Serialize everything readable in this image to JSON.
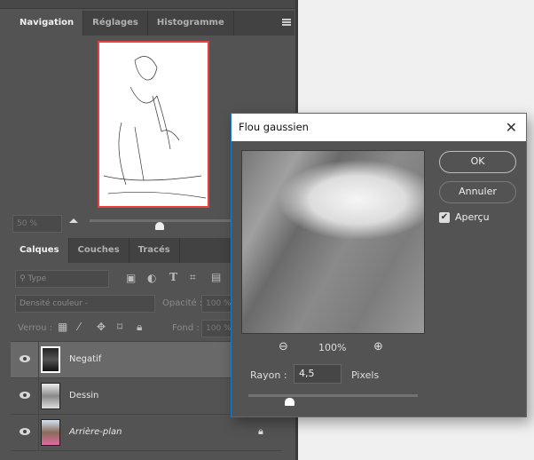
{
  "navigator": {
    "tabs": [
      "Navigation",
      "Réglages",
      "Histogramme"
    ],
    "zoom": "50 %"
  },
  "layers_panel": {
    "tabs": [
      "Calques",
      "Couches",
      "Tracés"
    ],
    "filter_placeholder": "Type",
    "blend_mode": "Densité couleur -",
    "opacity_label": "Opacité :",
    "opacity": "100 %",
    "lock_label": "Verrou :",
    "fill_label": "Fond :",
    "fill": "100 %",
    "layers": [
      {
        "name": "Negatif",
        "selected": true
      },
      {
        "name": "Dessin"
      },
      {
        "name": "Arrière-plan",
        "locked": true
      }
    ]
  },
  "dialog": {
    "title": "Flou gaussien",
    "ok": "OK",
    "cancel": "Annuler",
    "preview_label": "Aperçu",
    "preview_checked": true,
    "zoom": "100%",
    "radius_label": "Rayon :",
    "radius": "4,5",
    "unit": "Pixels",
    "radius_slider_fraction": 0.24
  },
  "colors": {
    "panel": "#535353",
    "accent_border": "#1979ca",
    "nav_frame": "#e84040"
  }
}
